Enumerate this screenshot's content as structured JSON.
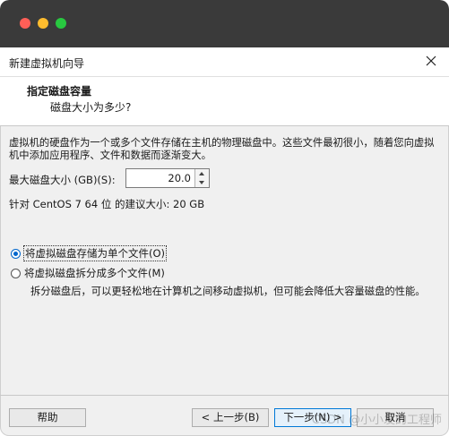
{
  "dialog": {
    "title": "新建虚拟机向导"
  },
  "header": {
    "title": "指定磁盘容量",
    "subtitle": "磁盘大小为多少?"
  },
  "content": {
    "description": "虚拟机的硬盘作为一个或多个文件存储在主机的物理磁盘中。这些文件最初很小，随着您向虚拟机中添加应用程序、文件和数据而逐渐变大。",
    "size_label": "最大磁盘大小 (GB)(S):",
    "size_value": "20.0",
    "recommend": "针对 CentOS 7 64 位 的建议大小: 20 GB"
  },
  "options": [
    {
      "label": "将虚拟磁盘存储为单个文件(O)",
      "checked": true
    },
    {
      "label": "将虚拟磁盘拆分成多个文件(M)",
      "checked": false
    }
  ],
  "split_description": "拆分磁盘后，可以更轻松地在计算机之间移动虚拟机，但可能会降低大容量磁盘的性能。",
  "buttons": {
    "help": "帮助",
    "back": "< 上一步(B)",
    "next": "下一步(N) >",
    "cancel": "取消"
  },
  "watermark": "CSDN @小小发的工程师"
}
